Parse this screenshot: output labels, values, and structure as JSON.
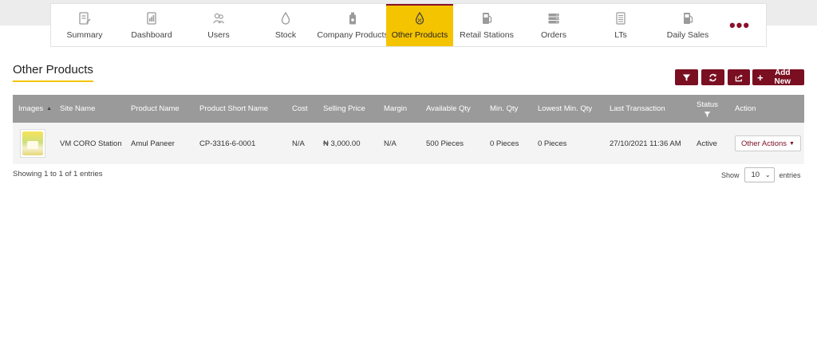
{
  "nav": {
    "items": [
      {
        "label": "Summary",
        "icon": "clipboard-edit-icon"
      },
      {
        "label": "Dashboard",
        "icon": "chart-document-icon"
      },
      {
        "label": "Users",
        "icon": "users-icon"
      },
      {
        "label": "Stock",
        "icon": "drop-icon"
      },
      {
        "label": "Company Products",
        "icon": "bottle-icon"
      },
      {
        "label": "Other Products",
        "icon": "drop-percent-icon",
        "active": true
      },
      {
        "label": "Retail Stations",
        "icon": "fuel-pump-icon"
      },
      {
        "label": "Orders",
        "icon": "server-stack-icon"
      },
      {
        "label": "LTs",
        "icon": "document-list-icon"
      },
      {
        "label": "Daily Sales",
        "icon": "fuel-pump-icon"
      }
    ],
    "more_label": "•••"
  },
  "page": {
    "title": "Other Products"
  },
  "toolbar": {
    "add_new_label": "Add New",
    "filter_icon": "filter-icon",
    "refresh_icon": "refresh-icon",
    "export_icon": "export-icon"
  },
  "table": {
    "columns": [
      "Images",
      "Site Name",
      "Product Name",
      "Product Short Name",
      "Cost",
      "Selling Price",
      "Margin",
      "Available Qty",
      "Min. Qty",
      "Lowest Min. Qty",
      "Last Transaction",
      "Status",
      "Action"
    ],
    "rows": [
      {
        "site_name": "VM CORO Station",
        "product_name": "Amul Paneer",
        "short_name": "CP-3316-6-0001",
        "cost": "N/A",
        "selling_price": "₦ 3,000.00",
        "margin": "N/A",
        "available_qty": "500 Pieces",
        "min_qty": "0 Pieces",
        "lowest_min_qty": "0 Pieces",
        "last_transaction": "27/10/2021 11:36 AM",
        "status": "Active",
        "action_label": "Other Actions"
      }
    ]
  },
  "footer": {
    "info": "Showing 1 to 1 of 1 entries",
    "show_label": "Show",
    "page_size": "10",
    "entries_label": "entries"
  },
  "colors": {
    "accent": "#f5c400",
    "brand": "#7a0f22",
    "header_bg": "#9a9a9a"
  }
}
